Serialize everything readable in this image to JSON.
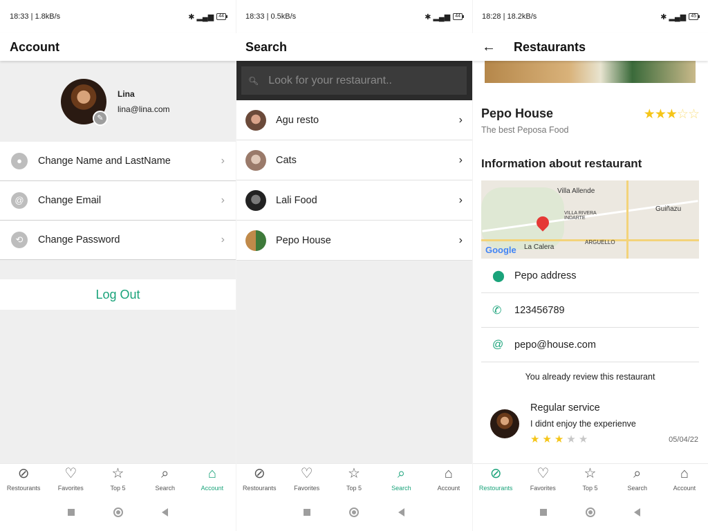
{
  "screens": {
    "account": {
      "status": {
        "time_speed": "18:33 | 1.8kB/s",
        "battery": "44"
      },
      "title": "Account",
      "profile": {
        "name": "Lina",
        "email": "lina@lina.com"
      },
      "menu": [
        {
          "label": "Change Name and LastName"
        },
        {
          "label": "Change Email"
        },
        {
          "label": "Change Password"
        }
      ],
      "logout": "Log Out"
    },
    "search": {
      "status": {
        "time_speed": "18:33 | 0.5kB/s",
        "battery": "44"
      },
      "title": "Search",
      "search_placeholder": "Look for your restaurant..",
      "results": [
        {
          "label": "Agu resto"
        },
        {
          "label": "Cats"
        },
        {
          "label": "Lali Food"
        },
        {
          "label": "Pepo House"
        }
      ]
    },
    "restaurant": {
      "status": {
        "time_speed": "18:28 | 18.2kB/s",
        "battery": "45"
      },
      "title": "Restaurants",
      "name": "Pepo House",
      "description": "The best Peposa Food",
      "rating": 3,
      "info_title": "Information about restaurant",
      "map": {
        "labels": [
          "Villa Allende",
          "VILLA RIVERA INDARTE",
          "Guiñazu",
          "ARGUELLO",
          "La Calera"
        ],
        "logo": "Google"
      },
      "address": "Pepo address",
      "phone": "123456789",
      "email": "pepo@house.com",
      "reviewed_notice": "You already review this restaurant",
      "review": {
        "title": "Regular service",
        "text": "I didnt enjoy the experienve",
        "rating": 3,
        "date": "05/04/22"
      }
    }
  },
  "nav": {
    "restaurants": "Restourants",
    "favorites": "Favorites",
    "top5": "Top 5",
    "search": "Search",
    "account": "Account"
  },
  "colors": {
    "accent": "#1aa37a",
    "star": "#f5c518"
  },
  "icons": {
    "nav": [
      "compass-icon",
      "heart-icon",
      "star-icon",
      "search-icon",
      "home-icon"
    ]
  }
}
